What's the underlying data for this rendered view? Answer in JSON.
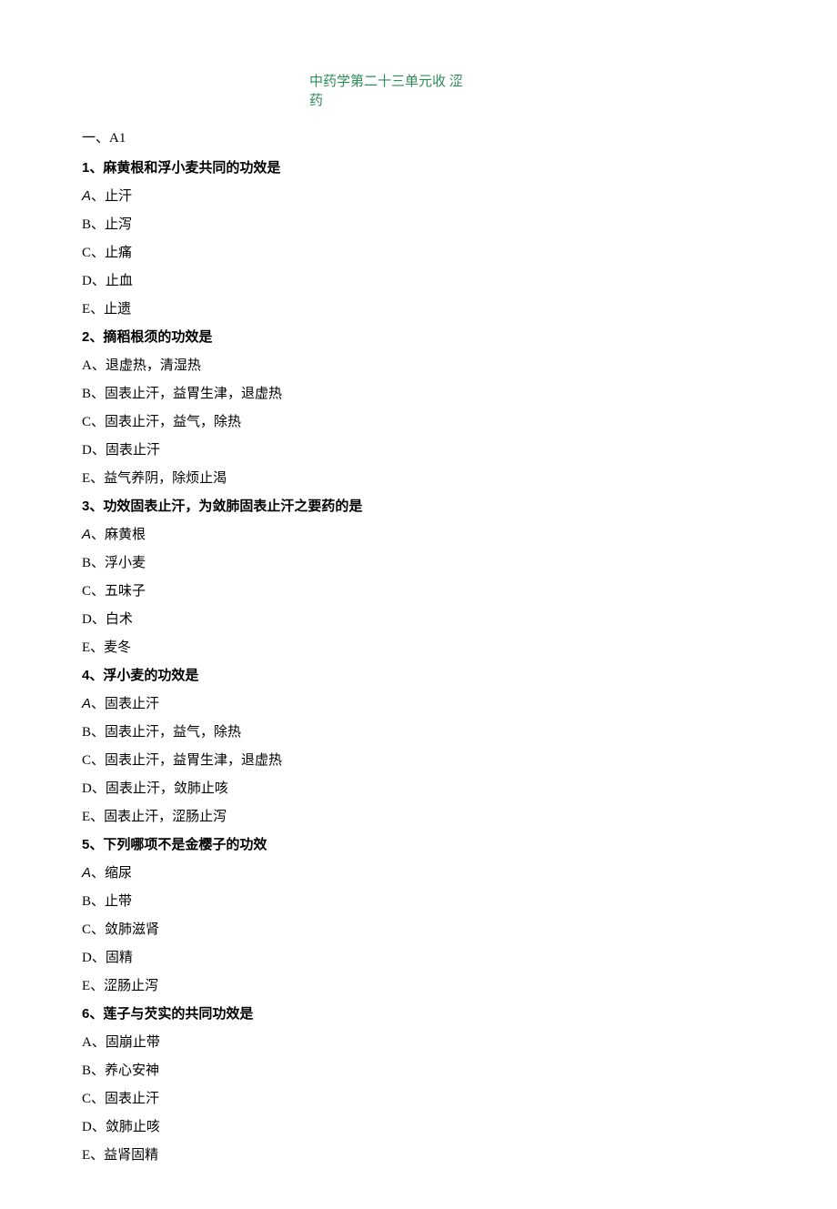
{
  "title": "中药学第二十三单元收\n涩药",
  "section_label": "一、A1",
  "questions": [
    {
      "q": "1、麻黄根和浮小麦共同的功效是",
      "first_italic_a": true,
      "options": [
        "A、止汗",
        "B、止泻",
        "C、止痛",
        "D、止血",
        "E、止遗"
      ]
    },
    {
      "q": "2、摘稻根须的功效是",
      "first_italic_a": false,
      "options": [
        "A、退虚热，清湿热",
        "B、固表止汗，益胃生津，退虚热",
        "C、固表止汗，益气，除热",
        "D、固表止汗",
        "E、益气养阴，除烦止渴"
      ]
    },
    {
      "q": "3、功效固表止汗，为敛肺固表止汗之要药的是",
      "first_italic_a": true,
      "options": [
        "A、麻黄根",
        "B、浮小麦",
        "C、五味子",
        "D、白术",
        "E、麦冬"
      ]
    },
    {
      "q": "4、浮小麦的功效是",
      "first_italic_a": true,
      "options": [
        "A、固表止汗",
        "B、固表止汗，益气，除热",
        "C、固表止汗，益胃生津，退虚热",
        "D、固表止汗，敛肺止咳",
        "E、固表止汗，涩肠止泻"
      ]
    },
    {
      "q": "5、下列哪项不是金樱子的功效",
      "first_italic_a": true,
      "options": [
        "A、缩尿",
        "B、止带",
        "C、敛肺滋肾",
        "D、固精",
        "E、涩肠止泻"
      ]
    },
    {
      "q": "6、莲子与芡实的共同功效是",
      "first_italic_a": false,
      "options": [
        "A、固崩止带",
        "B、养心安神",
        "C、固表止汗",
        "D、敛肺止咳",
        "E、益肾固精"
      ]
    }
  ]
}
